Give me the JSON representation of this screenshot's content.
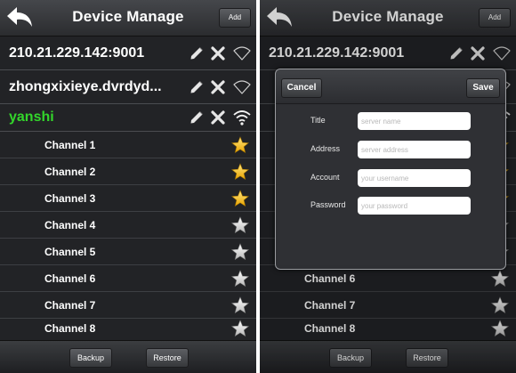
{
  "app": {
    "title": "Device Manage",
    "add_label": "Add"
  },
  "left_screen": {
    "servers": [
      {
        "name": "210.21.229.142:9001",
        "active": false
      },
      {
        "name": "zhongxixieye.dvrdyd...",
        "active": false
      },
      {
        "name": "yanshi",
        "active": true
      }
    ],
    "channels": [
      {
        "name": "Channel 1",
        "favorite": true
      },
      {
        "name": "Channel 2",
        "favorite": true
      },
      {
        "name": "Channel 3",
        "favorite": true
      },
      {
        "name": "Channel 4",
        "favorite": false
      },
      {
        "name": "Channel 5",
        "favorite": false
      },
      {
        "name": "Channel 6",
        "favorite": false
      },
      {
        "name": "Channel 7",
        "favorite": false
      },
      {
        "name": "Channel 8",
        "favorite": false
      }
    ]
  },
  "right_screen": {
    "server_name": "210.21.229.142:9001",
    "channels": [
      {
        "name": "Channel 6",
        "favorite": false
      },
      {
        "name": "Channel 7",
        "favorite": false
      },
      {
        "name": "Channel 8",
        "favorite": false
      }
    ],
    "dialog": {
      "cancel_label": "Cancel",
      "save_label": "Save",
      "fields": [
        {
          "label": "Title",
          "placeholder": "server name",
          "value": ""
        },
        {
          "label": "Address",
          "placeholder": "server address",
          "value": ""
        },
        {
          "label": "Account",
          "placeholder": "your username",
          "value": ""
        },
        {
          "label": "Password",
          "placeholder": "your password",
          "value": ""
        }
      ]
    }
  },
  "toolbar": {
    "backup_label": "Backup",
    "restore_label": "Restore"
  },
  "icons": {
    "back": "back-arrow-icon",
    "edit": "pencil-icon",
    "delete": "close-icon",
    "wifi": "wifi-icon",
    "favorite": "star-icon"
  },
  "colors": {
    "active_server": "#33d62b",
    "star_on": "#f7c21a",
    "star_off": "#d8d8d8"
  }
}
